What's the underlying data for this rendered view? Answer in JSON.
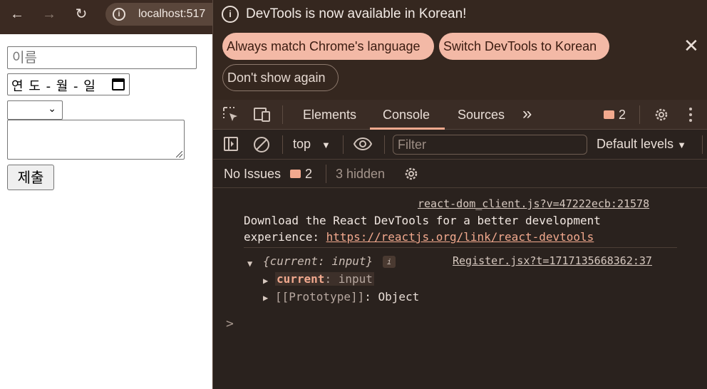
{
  "browser": {
    "back_icon": "←",
    "forward_icon": "→",
    "reload_icon": "↻",
    "info_icon": "i",
    "url": "localhost:517"
  },
  "form": {
    "name_placeholder": "이름",
    "date_placeholder": "연 도 - 월 - 일",
    "select_value": "",
    "textarea_value": "",
    "submit_label": "제출"
  },
  "devtools": {
    "infobar": {
      "icon": "i",
      "message": "DevTools is now available in Korean!",
      "always_match": "Always match Chrome's language",
      "switch_korean": "Switch DevTools to Korean",
      "dont_show": "Don't show again",
      "close": "✕"
    },
    "tabs": {
      "elements": "Elements",
      "console": "Console",
      "sources": "Sources",
      "more": "»",
      "issues_count": "2"
    },
    "toolbar": {
      "context": "top",
      "filter_placeholder": "Filter",
      "levels": "Default levels"
    },
    "issues": {
      "no_issues": "No Issues",
      "count": "2",
      "hidden": "3 hidden"
    },
    "console": {
      "log1_source": "react-dom_client.js?v=47222ecb:21578",
      "log1_line1": "Download the React DevTools for a better development",
      "log1_line2_prefix": "experience: ",
      "log1_link": "https://reactjs.org/link/react-devtools",
      "log2_source": "Register.jsx?t=1717135668362:37",
      "obj_preview": "{current: input}",
      "info_badge": "i",
      "prop_current_key": "current",
      "prop_current_val": ": input",
      "prop_proto_key": "[[Prototype]]",
      "prop_proto_val": ": Object",
      "prompt": ">"
    }
  },
  "colors": {
    "accent": "#f2a98e",
    "devtools_bg": "#2a221e",
    "infobar_bg": "#35271f"
  }
}
